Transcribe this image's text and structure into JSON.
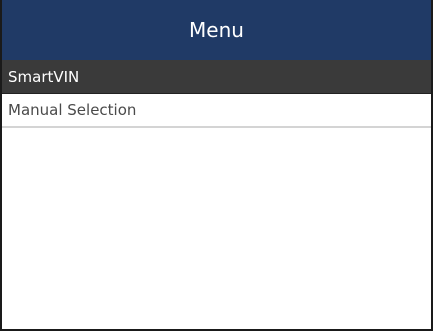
{
  "header": {
    "title": "Menu",
    "background_color": "#203a66"
  },
  "menu": {
    "items": [
      {
        "label": "SmartVIN",
        "selected": true
      },
      {
        "label": "Manual Selection",
        "selected": false
      }
    ],
    "selected_color": "#3a3a3a"
  }
}
